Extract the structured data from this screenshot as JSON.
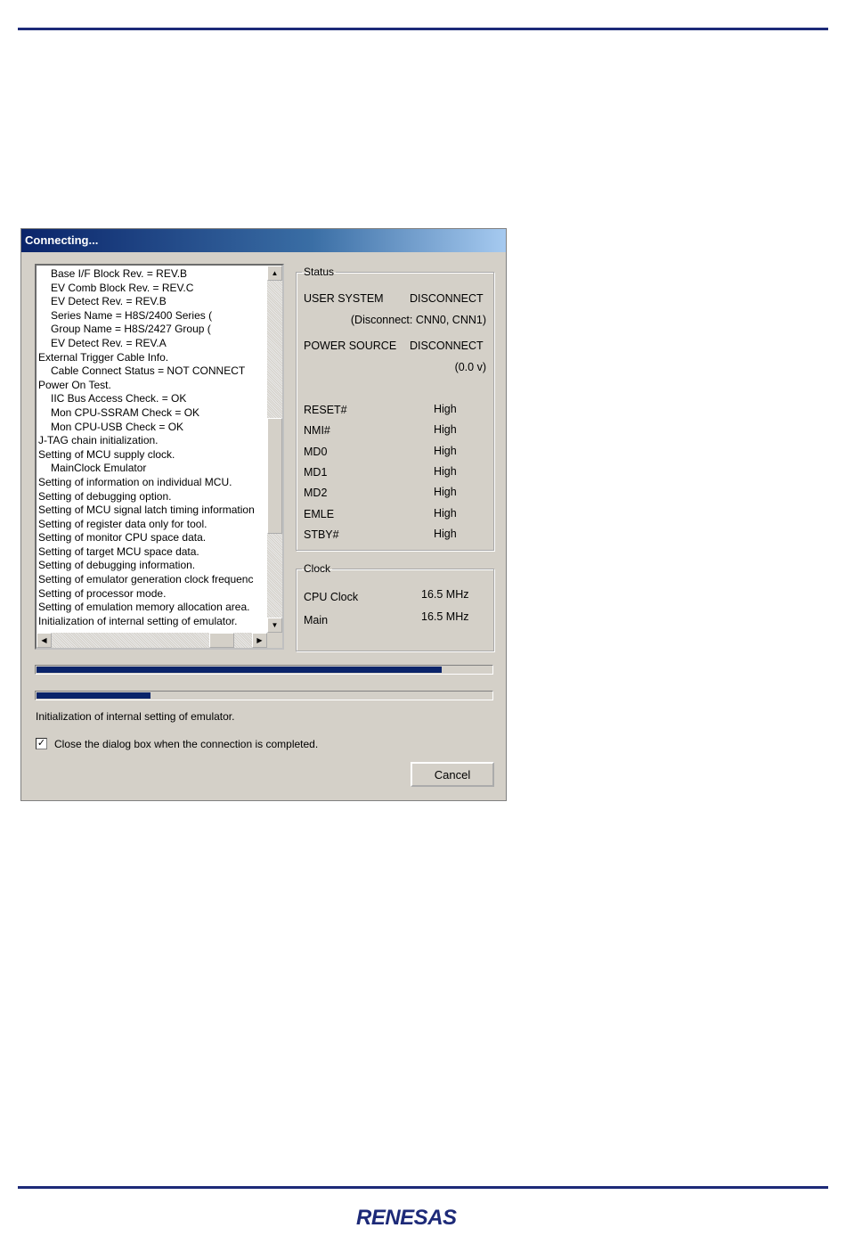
{
  "dialog": {
    "title": "Connecting...",
    "log_lines": [
      {
        "text": "Base I/F Block Rev.     = REV.B",
        "indent": true
      },
      {
        "text": "EV Comb Block Rev.      = REV.C",
        "indent": true
      },
      {
        "text": "EV Detect Rev.          = REV.B",
        "indent": true
      },
      {
        "text": "Series Name             = H8S/2400 Series (",
        "indent": true
      },
      {
        "text": "Group Name              = H8S/2427 Group (",
        "indent": true
      },
      {
        "text": "EV Detect Rev.          = REV.A",
        "indent": true
      },
      {
        "text": "External Trigger Cable Info.",
        "indent": false
      },
      {
        "text": "Cable Connect Status   = NOT CONNECT",
        "indent": true
      },
      {
        "text": "Power On Test.",
        "indent": false
      },
      {
        "text": "IIC Bus Access Check.   = OK",
        "indent": true
      },
      {
        "text": "Mon CPU-SSRAM Check     = OK",
        "indent": true
      },
      {
        "text": "Mon CPU-USB Check       = OK",
        "indent": true
      },
      {
        "text": "J-TAG chain initialization.",
        "indent": false
      },
      {
        "text": "Setting of MCU supply clock.",
        "indent": false
      },
      {
        "text": "MainClock Emulator",
        "indent": true
      },
      {
        "text": "Setting of information on individual MCU.",
        "indent": false
      },
      {
        "text": "Setting of debugging option.",
        "indent": false
      },
      {
        "text": "Setting of MCU signal latch timing information",
        "indent": false
      },
      {
        "text": "Setting of register data only for tool.",
        "indent": false
      },
      {
        "text": "Setting of monitor CPU space data.",
        "indent": false
      },
      {
        "text": "Setting of target MCU space data.",
        "indent": false
      },
      {
        "text": "Setting of debugging information.",
        "indent": false
      },
      {
        "text": "Setting of emulator generation clock frequenc",
        "indent": false
      },
      {
        "text": "Setting of processor mode.",
        "indent": false
      },
      {
        "text": "Setting of emulation memory allocation area.",
        "indent": false
      },
      {
        "text": "Initialization of internal setting of emulator.",
        "indent": false
      }
    ],
    "status": {
      "legend": "Status",
      "user_system_label": "USER SYSTEM",
      "user_system_value": "DISCONNECT",
      "user_system_detail": "(Disconnect: CNN0, CNN1)",
      "power_source_label": "POWER SOURCE",
      "power_source_value": "DISCONNECT",
      "power_source_detail": "(0.0 v)",
      "signals": [
        {
          "name": "RESET#",
          "value": "High"
        },
        {
          "name": "NMI#",
          "value": "High"
        },
        {
          "name": "MD0",
          "value": "High"
        },
        {
          "name": "MD1",
          "value": "High"
        },
        {
          "name": "MD2",
          "value": "High"
        },
        {
          "name": "EMLE",
          "value": "High"
        },
        {
          "name": "STBY#",
          "value": "High"
        }
      ]
    },
    "clock": {
      "legend": "Clock",
      "cpu_clock_label": "CPU Clock",
      "cpu_clock_value": "16.5 MHz",
      "main_label": "Main",
      "main_value": "16.5 MHz"
    },
    "progress_overall_fraction": 0.89,
    "progress_step_fraction": 0.25,
    "message": "Initialization of internal setting of emulator.",
    "close_when_done": {
      "checked": true,
      "label": "Close the dialog box when the connection is completed."
    },
    "cancel_label": "Cancel",
    "vscroll_fraction": 0.62,
    "hscroll_fraction": 0.9
  },
  "logo_text": "RENESAS",
  "colors": {
    "rule": "#1d2a78",
    "progress": "#0a246a",
    "logo": "#1d2a78"
  },
  "icons": {
    "scroll_up": "▲",
    "scroll_down": "▼",
    "scroll_left": "◀",
    "scroll_right": "▶",
    "check": "✓"
  }
}
